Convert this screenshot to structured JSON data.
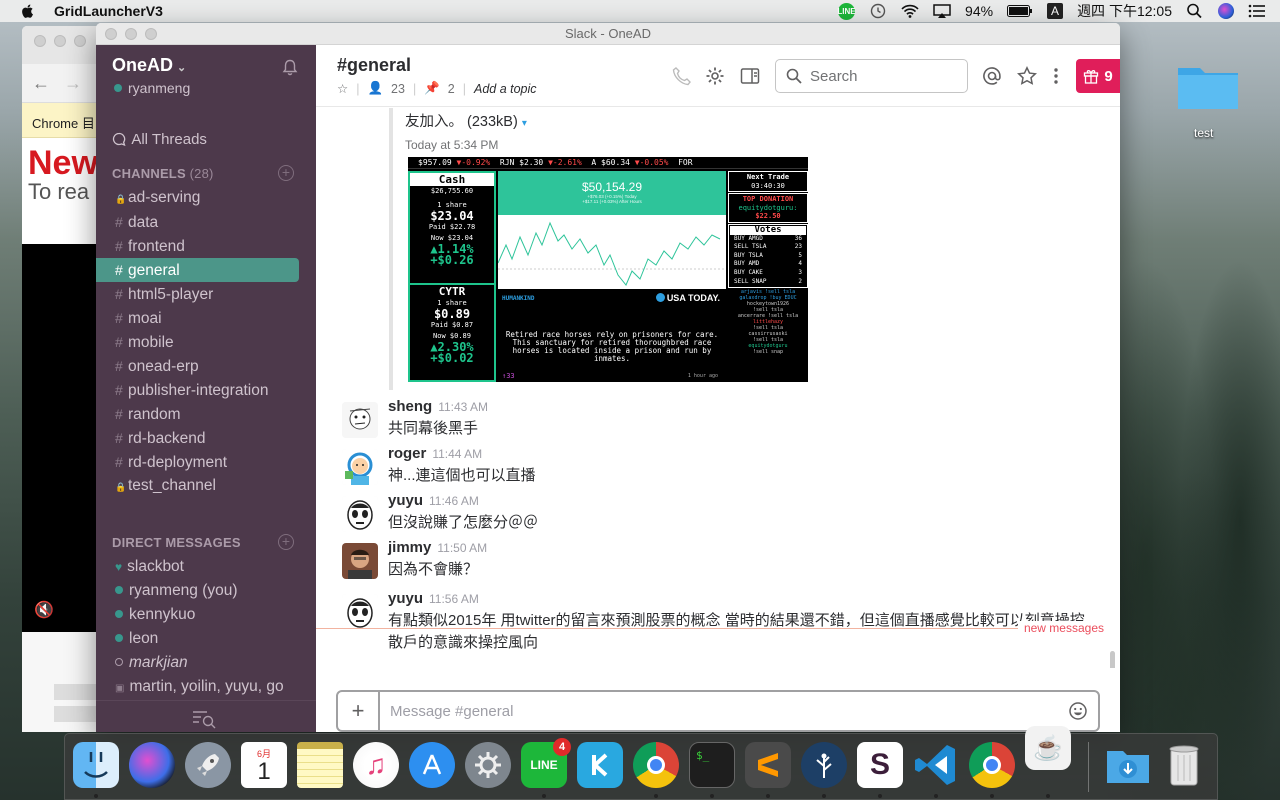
{
  "menubar": {
    "app_name": "GridLauncherV3",
    "line_label": "LINE",
    "battery": "94%",
    "input_source": "A",
    "clock": "週四 下午12:05"
  },
  "chrome": {
    "tab_label": "Chrome 目",
    "headline": "New",
    "subline": "To rea"
  },
  "slack": {
    "window_title": "Slack - OneAD",
    "team_name": "OneAD",
    "team_chevron": "⌄",
    "user_name": "ryanmeng",
    "all_threads": "All Threads",
    "channels_header": "CHANNELS",
    "channels_count": "(28)",
    "channels": [
      {
        "prefix": "🔒",
        "name": "ad-serving"
      },
      {
        "prefix": "#",
        "name": "data"
      },
      {
        "prefix": "#",
        "name": "frontend"
      },
      {
        "prefix": "#",
        "name": "general"
      },
      {
        "prefix": "#",
        "name": "html5-player"
      },
      {
        "prefix": "#",
        "name": "moai"
      },
      {
        "prefix": "#",
        "name": "mobile"
      },
      {
        "prefix": "#",
        "name": "onead-erp"
      },
      {
        "prefix": "#",
        "name": "publisher-integration"
      },
      {
        "prefix": "#",
        "name": "random"
      },
      {
        "prefix": "#",
        "name": "rd-backend"
      },
      {
        "prefix": "#",
        "name": "rd-deployment"
      },
      {
        "prefix": "🔒",
        "name": "test_channel"
      }
    ],
    "dm_header": "DIRECT MESSAGES",
    "dms": [
      {
        "name": "slackbot",
        "status": "heart"
      },
      {
        "name": "ryanmeng (you)",
        "status": "online"
      },
      {
        "name": "kennykuo",
        "status": "online"
      },
      {
        "name": "leon",
        "status": "online"
      },
      {
        "name": "markjian",
        "status": "away"
      },
      {
        "name": "martin, yoilin, yuyu, go",
        "status": "group"
      }
    ],
    "channel": {
      "name": "#general",
      "members": "23",
      "pins": "2",
      "topic_placeholder": "Add a topic",
      "search_placeholder": "Search",
      "gift_count": "9"
    },
    "attachment": {
      "filename": "友加入。 (233kB)",
      "caret": "▾",
      "timestamp": "Today at 5:34 PM"
    },
    "stream": {
      "ticker": [
        {
          "t": "$957.09 ",
          "c": "w"
        },
        {
          "t": "▼-0.92%",
          "c": "r"
        },
        {
          "t": "  RJN ",
          "c": "w"
        },
        {
          "t": "$2.30 ",
          "c": "w"
        },
        {
          "t": "▼-2.61%",
          "c": "r"
        },
        {
          "t": "  A ",
          "c": "w"
        },
        {
          "t": "$60.34 ",
          "c": "w"
        },
        {
          "t": "▼-0.05%",
          "c": "r"
        },
        {
          "t": "  FOR",
          "c": "w"
        }
      ],
      "cash_label": "Cash",
      "cash_value": "$26,755.60",
      "stock1": {
        "shares": "1 share",
        "price": "$23.04",
        "paid": "Paid $22.78",
        "now": "Now $23.04",
        "pct": "▲1.14%",
        "gain": "+$0.26"
      },
      "portfolio_value": "$50,154.29",
      "portfolio_change": "+$76.03 (+0.15%) Today",
      "portfolio_after": "+$17.11 (+0.03%) After Hours",
      "stock2": {
        "name": "CYTR",
        "shares": "1 share",
        "price": "$0.89",
        "paid": "Paid $0.87",
        "now": "Now $0.89",
        "pct": "▲2.30%",
        "gain": "+$0.02"
      },
      "news_source": "HUMANKIND",
      "news_brand": "USA TODAY.",
      "news_text": "Retired race horses rely on prisoners for care. This sanctuary for retired thoroughbred race horses is located inside a prison and run by inmates.",
      "news_footer": "↑33",
      "news_ago": "1 hour ago",
      "next_trade_label": "Next Trade",
      "next_trade_time": "03:40:30",
      "donation_label": "TOP DONATION",
      "donation_user": "equitydotguru:",
      "donation_amount": "$22.50",
      "votes_label": "Votes",
      "votes": [
        {
          "label": "BUY AMGD",
          "n": "36"
        },
        {
          "label": "SELL TSLA",
          "n": "23"
        },
        {
          "label": "BUY TSLA",
          "n": "5"
        },
        {
          "label": "BUY AMD",
          "n": "4"
        },
        {
          "label": "BUY CAKE",
          "n": "3"
        },
        {
          "label": "SELL SNAP",
          "n": "2"
        }
      ],
      "chat": [
        {
          "t": "arjavis !sell tsla",
          "c": "c1"
        },
        {
          "t": "galaxdrop !buy EDUC",
          "c": "c1"
        },
        {
          "t": "hockeytown1926",
          "c": ""
        },
        {
          "t": "!sell tsla",
          "c": ""
        },
        {
          "t": "ancerrare !sell tsla",
          "c": ""
        },
        {
          "t": "littlehazy",
          "c": "c3"
        },
        {
          "t": "!sell tsla",
          "c": ""
        },
        {
          "t": "cassirrusaski",
          "c": ""
        },
        {
          "t": "!sell tsla",
          "c": ""
        },
        {
          "t": "equitydotguru",
          "c": "c4"
        },
        {
          "t": "!sell snap",
          "c": ""
        }
      ]
    },
    "messages": [
      {
        "user": "sheng",
        "time": "11:43 AM",
        "text": "共同幕後黑手"
      },
      {
        "user": "roger",
        "time": "11:44 AM",
        "text": "神...連這個也可以直播"
      },
      {
        "user": "yuyu",
        "time": "11:46 AM",
        "text": "但沒說賺了怎麼分＠＠"
      },
      {
        "user": "jimmy",
        "time": "11:50 AM",
        "text": "因為不會賺？"
      },
      {
        "user": "yuyu",
        "time": "11:56 AM",
        "text": "有點類似2015年 用twitter的留言來預測股票的概念 當時的結果還不錯，但這個直播感覺比較可以刻意操控散戶的意識來操控風向"
      }
    ],
    "new_messages_label": "new messages",
    "composer_placeholder": "Message #general"
  },
  "desktop": {
    "folder_label": "test"
  },
  "dock": {
    "calendar_month": "6月",
    "calendar_day": "1",
    "line_badge": "4",
    "line_label": "LINE"
  }
}
